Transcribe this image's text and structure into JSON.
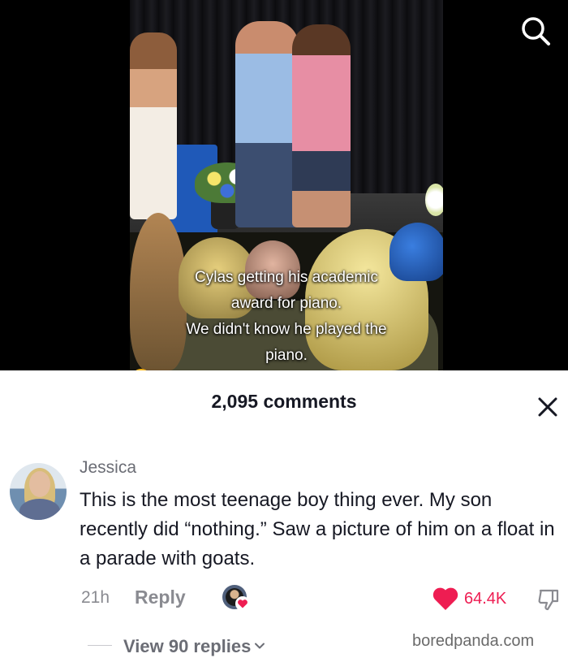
{
  "video": {
    "caption_lines": [
      "Cylas getting his academic",
      "award for piano.",
      "We didn't know he played the",
      "piano."
    ],
    "caption_emoji": "rolling-on-floor-laughing",
    "search_icon": "search-icon"
  },
  "comments_sheet": {
    "title": "2,095 comments",
    "close_icon": "close-icon"
  },
  "comment": {
    "author": "Jessica",
    "text": "This is the most teenage boy thing ever. My son recently did “nothing.” Saw a picture of him on a float in a parade with goats.",
    "time": "21h",
    "reply_label": "Reply",
    "creator_liked_icon": "creator-liked-icon",
    "like_count": "64.4K",
    "like_color": "#ee1d52",
    "like_icon": "heart-icon",
    "dislike_icon": "thumbs-down-icon"
  },
  "replies": {
    "label": "View 90 replies"
  },
  "watermark": "boredpanda.com"
}
